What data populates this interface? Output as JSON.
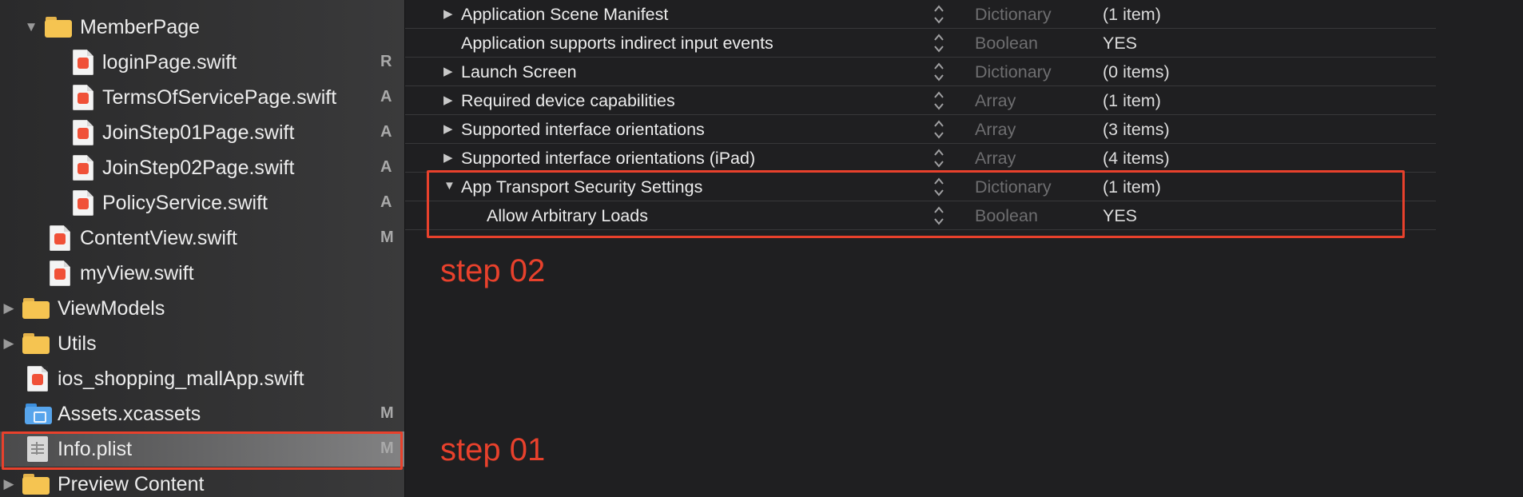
{
  "sidebar": {
    "items": [
      {
        "label": "MemberPage",
        "status": "",
        "kind": "folder",
        "expanded": true
      },
      {
        "label": "loginPage.swift",
        "status": "R",
        "kind": "swift"
      },
      {
        "label": "TermsOfServicePage.swift",
        "status": "A",
        "kind": "swift"
      },
      {
        "label": "JoinStep01Page.swift",
        "status": "A",
        "kind": "swift"
      },
      {
        "label": "JoinStep02Page.swift",
        "status": "A",
        "kind": "swift"
      },
      {
        "label": "PolicyService.swift",
        "status": "A",
        "kind": "swift"
      },
      {
        "label": "ContentView.swift",
        "status": "M",
        "kind": "swift"
      },
      {
        "label": "myView.swift",
        "status": "",
        "kind": "swift"
      },
      {
        "label": "ViewModels",
        "status": "",
        "kind": "folder",
        "expanded": false
      },
      {
        "label": "Utils",
        "status": "",
        "kind": "folder",
        "expanded": false
      },
      {
        "label": "ios_shopping_mallApp.swift",
        "status": "",
        "kind": "swift"
      },
      {
        "label": "Assets.xcassets",
        "status": "M",
        "kind": "assets"
      },
      {
        "label": "Info.plist",
        "status": "M",
        "kind": "plist",
        "selected": true
      },
      {
        "label": "Preview Content",
        "status": "",
        "kind": "folder",
        "expanded": false
      }
    ]
  },
  "plist": {
    "rows": [
      {
        "key": "Application Scene Manifest",
        "type": "Dictionary",
        "value": "(1 item)",
        "expandable": true,
        "expanded": false
      },
      {
        "key": "Application supports indirect input events",
        "type": "Boolean",
        "value": "YES",
        "expandable": false
      },
      {
        "key": "Launch Screen",
        "type": "Dictionary",
        "value": "(0 items)",
        "expandable": true,
        "expanded": false
      },
      {
        "key": "Required device capabilities",
        "type": "Array",
        "value": "(1 item)",
        "expandable": true,
        "expanded": false
      },
      {
        "key": "Supported interface orientations",
        "type": "Array",
        "value": "(3 items)",
        "expandable": true,
        "expanded": false
      },
      {
        "key": "Supported interface orientations (iPad)",
        "type": "Array",
        "value": "(4 items)",
        "expandable": true,
        "expanded": false
      },
      {
        "key": "App Transport Security Settings",
        "type": "Dictionary",
        "value": "(1 item)",
        "expandable": true,
        "expanded": true
      },
      {
        "key": "Allow Arbitrary Loads",
        "type": "Boolean",
        "value": "YES",
        "expandable": false,
        "child": true
      }
    ]
  },
  "annotations": {
    "step01": "step 01",
    "step02": "step 02"
  },
  "colors": {
    "highlight": "#e8412c",
    "background": "#1f1f21",
    "type_text": "#6e6e70"
  }
}
